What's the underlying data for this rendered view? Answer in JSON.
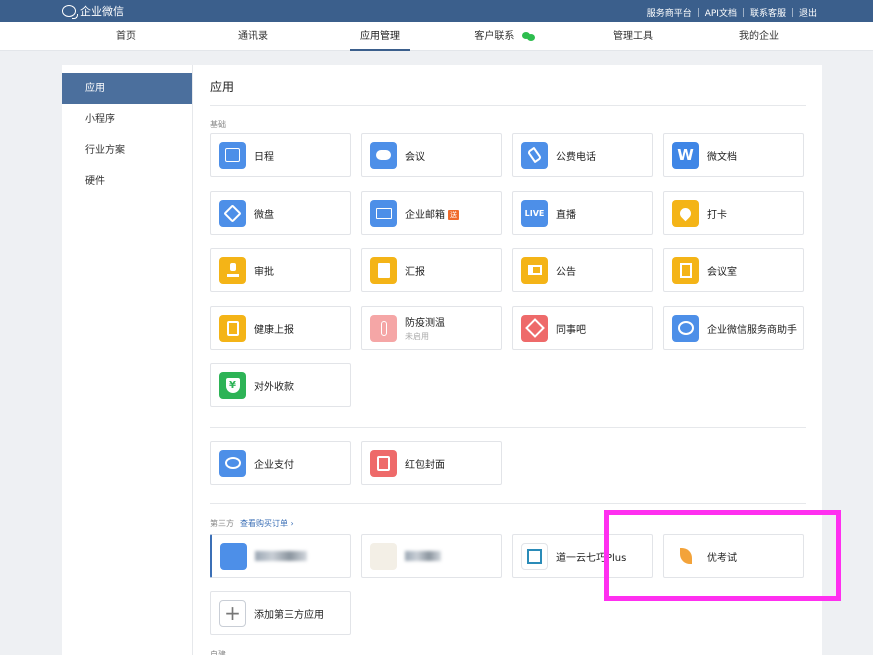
{
  "topbar": {
    "brand": "企业微信",
    "links": [
      "服务商平台",
      "API文档",
      "联系客服",
      "退出"
    ]
  },
  "nav": {
    "items": [
      "首页",
      "通讯录",
      "应用管理",
      "客户联系",
      "管理工具",
      "我的企业"
    ],
    "active": "应用管理"
  },
  "sidebar": {
    "items": [
      "应用",
      "小程序",
      "行业方案",
      "硬件"
    ],
    "active": "应用"
  },
  "page": {
    "title": "应用",
    "section_basic": "基础",
    "section_third": "第三方",
    "view_orders_link": "查看购买订单 ›",
    "section_custom": "自建"
  },
  "basic_apps": [
    {
      "label": "日程",
      "icon": "calendar-icon",
      "color": "#4d8fe8"
    },
    {
      "label": "会议",
      "icon": "meeting-cloud-icon",
      "color": "#4d8fe8"
    },
    {
      "label": "公费电话",
      "icon": "phone-icon",
      "color": "#4d8fe8"
    },
    {
      "label": "微文档",
      "icon": "wedoc-icon",
      "color": "#3f86e6"
    },
    {
      "label": "微盘",
      "icon": "drive-icon",
      "color": "#4d8fe8"
    },
    {
      "label": "企业邮箱",
      "icon": "mail-icon",
      "color": "#4d8fe8",
      "badge": "送"
    },
    {
      "label": "直播",
      "icon": "live-icon",
      "color": "#4d8fe8"
    },
    {
      "label": "打卡",
      "icon": "location-pin-icon",
      "color": "#f4b417"
    },
    {
      "label": "审批",
      "icon": "stamp-icon",
      "color": "#f4b417"
    },
    {
      "label": "汇报",
      "icon": "report-icon",
      "color": "#f4b417"
    },
    {
      "label": "公告",
      "icon": "megaphone-icon",
      "color": "#f4b417"
    },
    {
      "label": "会议室",
      "icon": "door-icon",
      "color": "#f4b417"
    },
    {
      "label": "健康上报",
      "icon": "health-clipboard-icon",
      "color": "#f4b417"
    },
    {
      "label": "防疫测温",
      "sublabel": "未启用",
      "icon": "thermometer-icon",
      "color": "#f5a6a6"
    },
    {
      "label": "同事吧",
      "icon": "colleague-nodes-icon",
      "color": "#ee6a6a"
    },
    {
      "label": "企业微信服务商助手",
      "icon": "assistant-bubble-icon",
      "color": "#4d8fe8"
    },
    {
      "label": "对外收款",
      "icon": "payment-yuan-icon",
      "color": "#2db356",
      "glyph": "¥"
    }
  ],
  "pay_apps": [
    {
      "label": "企业支付",
      "icon": "enterprise-pay-icon",
      "color": "#4d8fe8"
    },
    {
      "label": "红包封面",
      "icon": "red-packet-icon",
      "color": "#ee6a6a"
    }
  ],
  "third_apps": [
    {
      "label": "",
      "icon": "blurred-app-icon",
      "color": "#4d8fe8"
    },
    {
      "label": "",
      "icon": "blurred-app-icon-2",
      "color": "#f3efe6"
    },
    {
      "label": "道一云七巧Plus",
      "icon": "qiqiao-icon",
      "color": "#ffffff"
    },
    {
      "label": "优考试",
      "icon": "youkaoshi-icon",
      "color": "#ffffff"
    }
  ],
  "add_third": {
    "label": "添加第三方应用",
    "icon": "plus-icon"
  },
  "live_glyph": "LIVE",
  "wedoc_glyph": "W"
}
